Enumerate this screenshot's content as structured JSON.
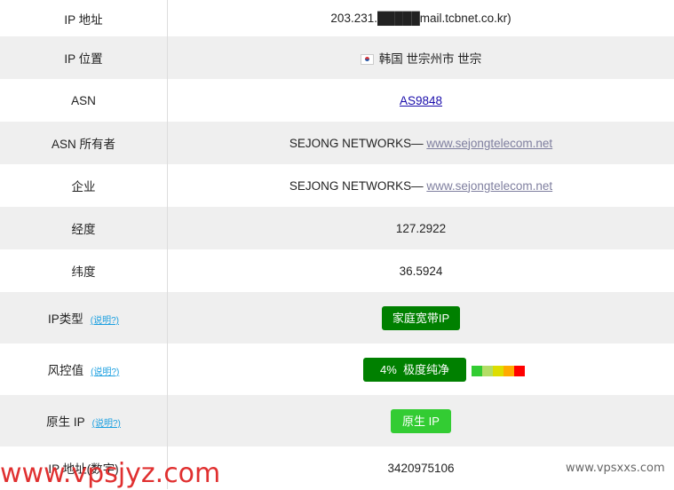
{
  "rows": [
    {
      "label": "IP 地址",
      "value": "203.231.█████mail.tcbnet.co.kr)"
    },
    {
      "label": "IP 位置",
      "flag": "kr-flag-icon",
      "value": "韩国 世宗州市 世宗"
    },
    {
      "label": "ASN",
      "value": "AS9848"
    },
    {
      "label": "ASN 所有者",
      "org": "SEJONG NETWORKS— ",
      "site": "www.sejongtelecom.net"
    },
    {
      "label": "企业",
      "org": "SEJONG NETWORKS— ",
      "site": "www.sejongtelecom.net"
    },
    {
      "label": "经度",
      "value": "127.2922"
    },
    {
      "label": "纬度",
      "value": "36.5924"
    },
    {
      "label": "IP类型",
      "help": "(说明?)",
      "badge": "家庭宽带IP"
    },
    {
      "label": "风控值",
      "help": "(说明?)",
      "badge": "4%  极度纯净",
      "risk_percent": 4,
      "scale_colors": [
        "#33cc33",
        "#b3dd66",
        "#dddd00",
        "#ffaa00",
        "#ff0000"
      ]
    },
    {
      "label": "原生 IP",
      "help": "(说明?)",
      "badge": "原生 IP"
    },
    {
      "label": "IP 地址(数字)",
      "value": "3420975106"
    }
  ],
  "colors": {
    "badge_green": "#008000",
    "badge_light_green": "#33cc33",
    "help_link": "#1a9fe0"
  },
  "watermarks": {
    "left": "www.vpsjyz.com",
    "right": "www.vpsxxs.com"
  }
}
